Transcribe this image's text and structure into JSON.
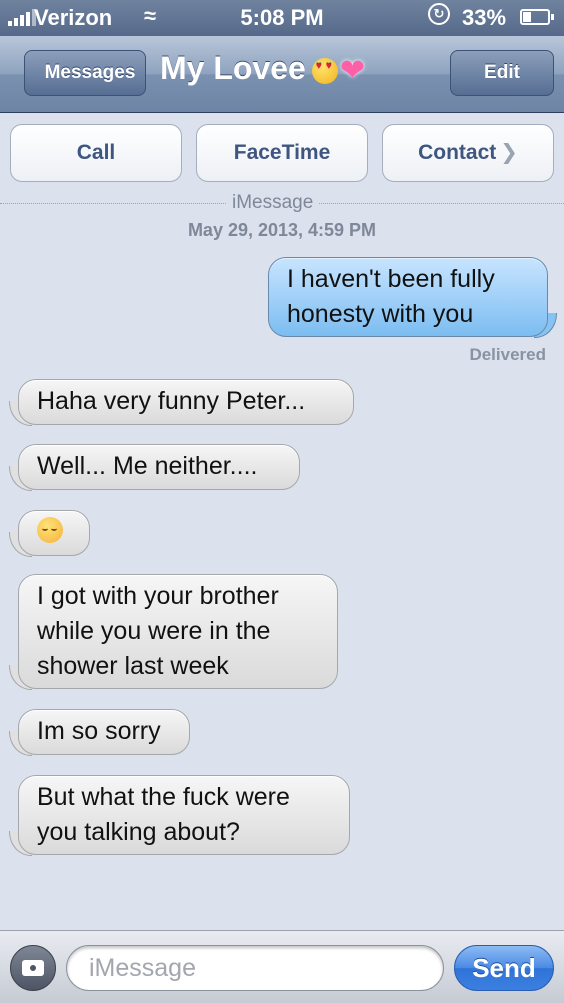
{
  "status_bar": {
    "carrier": "Verizon",
    "time": "5:08 PM",
    "battery": "33%",
    "icons": [
      "signal-icon",
      "wifi-icon",
      "rotation-lock-icon",
      "battery-icon"
    ]
  },
  "nav": {
    "back_label": "Messages",
    "title": "My Lovee",
    "title_emoji": [
      "heart-eyes-emoji",
      "sparkling-heart-emoji"
    ],
    "edit_label": "Edit"
  },
  "actions": {
    "call": "Call",
    "facetime": "FaceTime",
    "contact": "Contact"
  },
  "thread": {
    "service": "iMessage",
    "date": "May 29, 2013, 4:59 PM",
    "delivered": "Delivered",
    "messages": [
      {
        "from": "me",
        "lines": [
          "I haven't been fully",
          "honesty with you"
        ]
      },
      {
        "from": "them",
        "lines": [
          "Haha very funny Peter..."
        ]
      },
      {
        "from": "them",
        "lines": [
          "Well... Me neither...."
        ]
      },
      {
        "from": "them",
        "emoji": "pensive-face-emoji"
      },
      {
        "from": "them",
        "lines": [
          "I got with your brother",
          "while you were in the",
          "shower last week"
        ]
      },
      {
        "from": "them",
        "lines": [
          "Im so sorry"
        ]
      },
      {
        "from": "them",
        "lines": [
          "But what the fuck were",
          "you talking about?"
        ]
      }
    ]
  },
  "composer": {
    "placeholder": "iMessage",
    "send_label": "Send"
  },
  "colors": {
    "background": "#dbe2ed",
    "outgoing_bubble": "#8ec8f5",
    "incoming_bubble": "#e6e6e6",
    "send_button": "#3b80e0"
  }
}
